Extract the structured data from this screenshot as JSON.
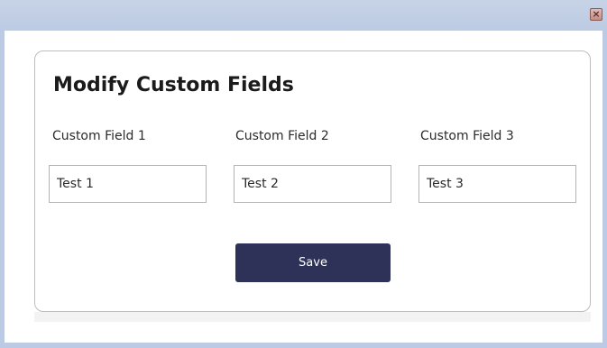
{
  "window": {
    "close_glyph": "×",
    "close_icon": "close-icon"
  },
  "dialog": {
    "title": "Modify Custom Fields",
    "fields": [
      {
        "label": "Custom Field 1",
        "value": "Test 1"
      },
      {
        "label": "Custom Field 2",
        "value": "Test 2"
      },
      {
        "label": "Custom Field 3",
        "value": "Test 3"
      }
    ],
    "save_label": "Save"
  },
  "colors": {
    "titlebar": "#bccbe3",
    "save_button_bg": "#2e3258",
    "save_button_text": "#ffffff",
    "close_button": "#c48c85"
  }
}
